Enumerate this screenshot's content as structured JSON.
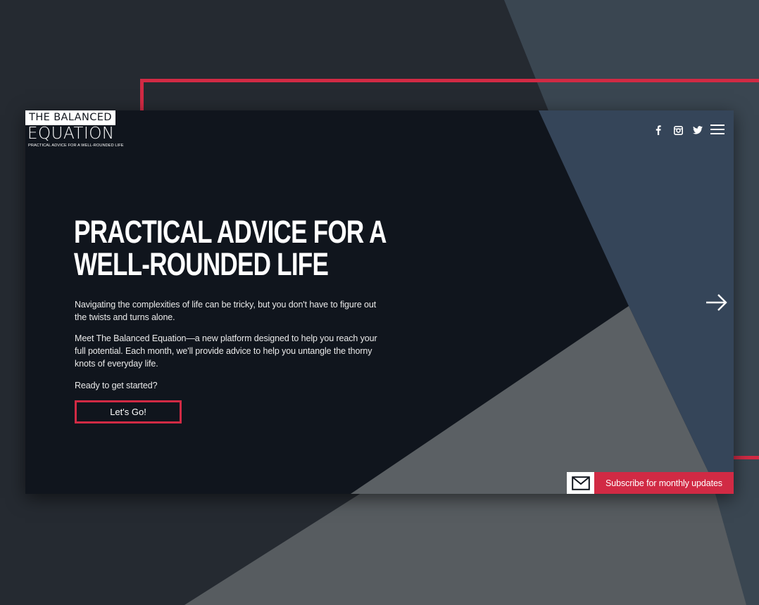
{
  "colors": {
    "accent_red": "#d12a44",
    "card_dark": "#10151d",
    "slate_blue": "#354559",
    "mid_gray": "#5b6064",
    "page_bg": "#252a31"
  },
  "logo": {
    "line1": "THE BALANCED",
    "line2": "EQUATION",
    "tagline": "PRACTICAL ADVICE FOR A WELL-ROUNDED LIFE"
  },
  "header": {
    "social_icons": [
      "facebook-icon",
      "instagram-icon",
      "twitter-icon"
    ],
    "menu_icon": "hamburger-menu-icon"
  },
  "hero": {
    "title_line1": "PRACTICAL ADVICE FOR A",
    "title_line2": "WELL-ROUNDED LIFE",
    "paragraph1": "Navigating the complexities of life can be tricky, but you don't have to figure out the twists and turns alone.",
    "paragraph2": "Meet The Balanced Equation—a new platform designed to help you reach your full potential. Each month, we'll provide advice to help you untangle the thorny knots of everyday life.",
    "paragraph3": "Ready to get started?",
    "cta_label": "Let's Go!"
  },
  "navigation": {
    "next_icon": "arrow-right-icon"
  },
  "subscribe": {
    "icon": "envelope-icon",
    "label": "Subscribe for monthly updates"
  }
}
